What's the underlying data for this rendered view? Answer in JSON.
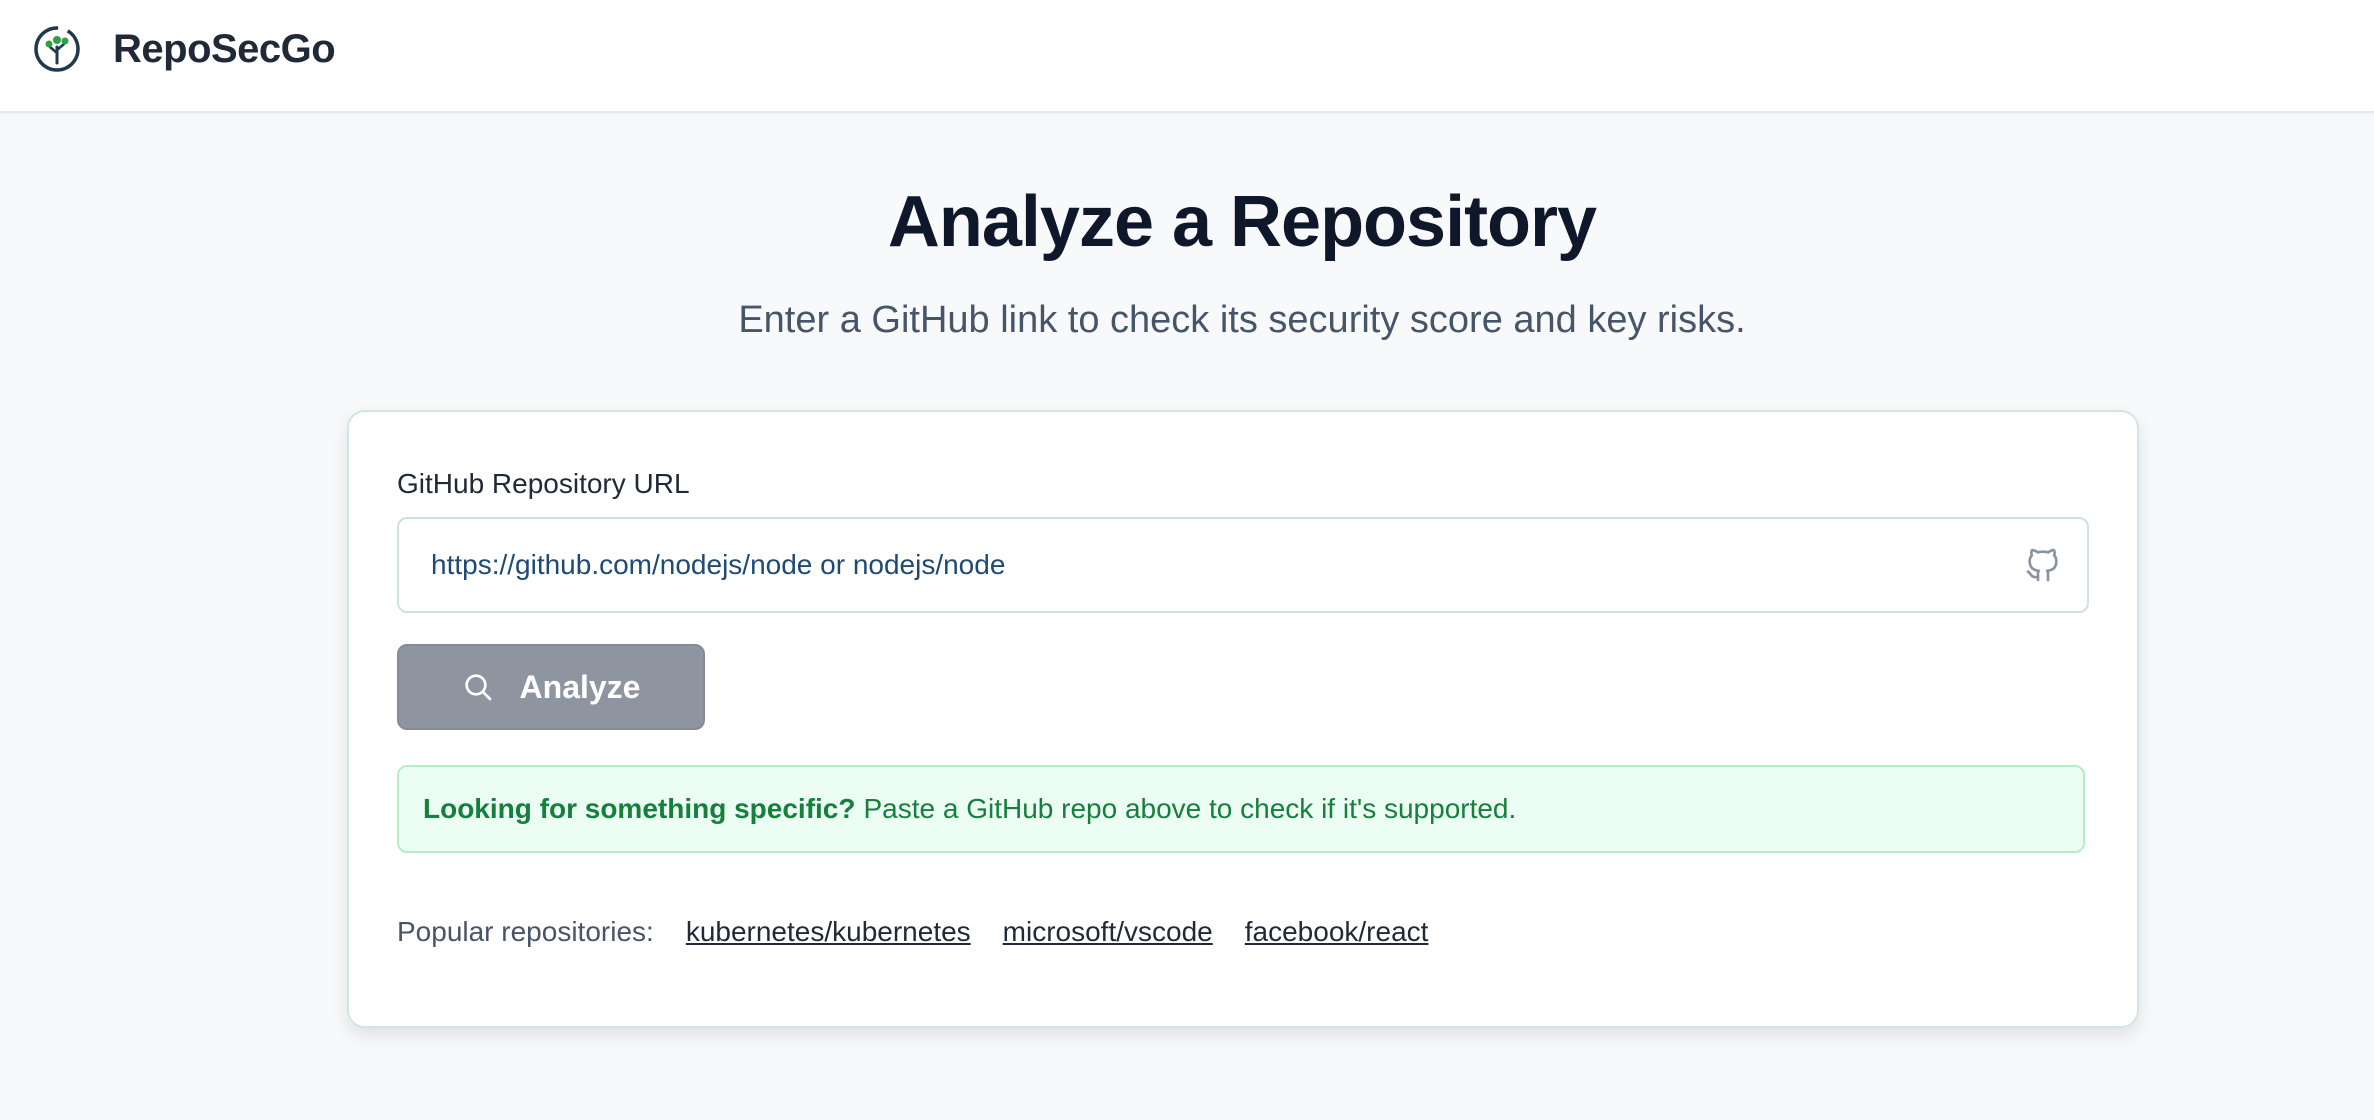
{
  "header": {
    "brand": "RepoSecGo",
    "logo_icon": "tree-logo-icon"
  },
  "hero": {
    "title": "Analyze a Repository",
    "subtitle": "Enter a GitHub link to check its security score and key risks."
  },
  "form": {
    "label": "GitHub Repository URL",
    "placeholder": "https://github.com/nodejs/node or nodejs/node",
    "value": "",
    "input_icon": "github-icon",
    "analyze_label": "Analyze",
    "analyze_icon": "search-icon"
  },
  "notice": {
    "strong": "Looking for something specific?",
    "text": "Paste a GitHub repo above to check if it's supported."
  },
  "popular": {
    "label": "Popular repositories:",
    "repos": [
      "kubernetes/kubernetes",
      "microsoft/vscode",
      "facebook/react"
    ]
  },
  "colors": {
    "accent_green": "#15803d",
    "button_disabled": "#8f95a0",
    "notice_bg": "#ecfdf3"
  }
}
